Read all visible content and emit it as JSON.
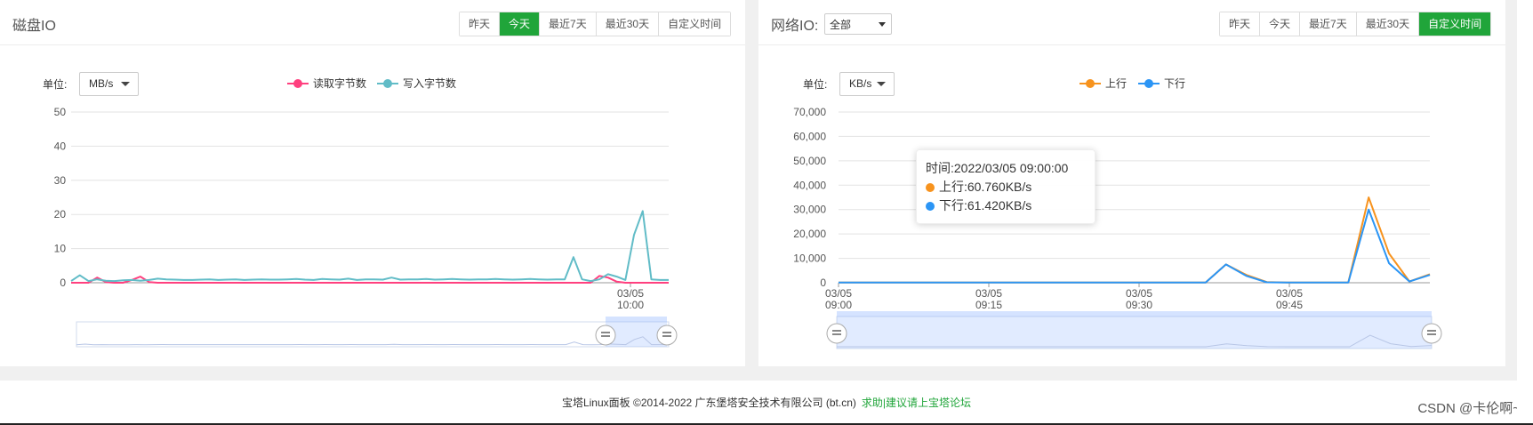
{
  "disk": {
    "title": "磁盘IO",
    "ranges": [
      "昨天",
      "今天",
      "最近7天",
      "最近30天",
      "自定义时间"
    ],
    "active_range": "今天",
    "unit_label": "单位:",
    "unit": "MB/s",
    "legend": [
      "读取字节数",
      "写入字节数"
    ]
  },
  "net": {
    "title": "网络IO:",
    "nic": "全部",
    "ranges": [
      "昨天",
      "今天",
      "最近7天",
      "最近30天",
      "自定义时间"
    ],
    "active_range": "自定义时间",
    "unit_label": "单位:",
    "unit": "KB/s",
    "legend": [
      "上行",
      "下行"
    ],
    "tooltip": {
      "time": "时间:2022/03/05 09:00:00",
      "up": "上行:60.760KB/s",
      "down": "下行:61.420KB/s"
    }
  },
  "colors": {
    "accent": "#20a53a",
    "read": "#ff407f",
    "write": "#61bcc7",
    "up": "#f7931e",
    "down": "#2b95f5"
  },
  "chart_data": [
    {
      "type": "line",
      "title": "",
      "xlabel": "",
      "ylabel": "",
      "ylim": [
        0,
        50
      ],
      "yticks": [
        0,
        10,
        20,
        30,
        40,
        50
      ],
      "xtick_labels": [
        "03/05\n10:00"
      ],
      "x": [
        0,
        1,
        2,
        3,
        4,
        5,
        6,
        7,
        8,
        9,
        10,
        11,
        12,
        13,
        14,
        15,
        16,
        17,
        18,
        19,
        20,
        21,
        22,
        23,
        24,
        25,
        26,
        27,
        28,
        29,
        30,
        31,
        32,
        33,
        34,
        35,
        36,
        37,
        38,
        39,
        40,
        41,
        42,
        43,
        44,
        45,
        46,
        47,
        48,
        49,
        50,
        51,
        52,
        53,
        54,
        55,
        56,
        57,
        58,
        59,
        60,
        61,
        62,
        63,
        64,
        65,
        66,
        67,
        68,
        69
      ],
      "series": [
        {
          "name": "读取字节数",
          "values": [
            0,
            0,
            0,
            1.5,
            0.2,
            0,
            0,
            0.8,
            1.8,
            0.2,
            0,
            0,
            0,
            0,
            0,
            0,
            0,
            0,
            0,
            0,
            0,
            0,
            0,
            0,
            0,
            0,
            0,
            0,
            0,
            0,
            0,
            0,
            0,
            0,
            0,
            0,
            0,
            0,
            0,
            0,
            0,
            0,
            0,
            0,
            0,
            0,
            0,
            0,
            0,
            0,
            0,
            0,
            0,
            0,
            0,
            0,
            0,
            0,
            0,
            0,
            0,
            2.0,
            1.5,
            0.3,
            0,
            0,
            0,
            0,
            0,
            0
          ]
        },
        {
          "name": "写入字节数",
          "values": [
            0.5,
            2.2,
            0.5,
            1.0,
            0.6,
            0.5,
            0.7,
            0.8,
            0.6,
            0.8,
            1.2,
            1.0,
            0.9,
            0.8,
            0.8,
            0.9,
            1.0,
            0.8,
            0.9,
            1.0,
            0.8,
            0.9,
            1.0,
            0.9,
            0.9,
            1.0,
            1.1,
            0.9,
            0.8,
            1.1,
            1.0,
            0.9,
            1.2,
            0.8,
            1.0,
            1.0,
            0.9,
            1.5,
            0.9,
            1.0,
            1.0,
            1.1,
            0.9,
            1.0,
            1.1,
            1.0,
            0.9,
            1.0,
            1.0,
            1.1,
            1.0,
            0.9,
            1.0,
            1.1,
            1.0,
            0.9,
            1.0,
            1.0,
            7.5,
            1.0,
            0.5,
            1.0,
            2.5,
            1.8,
            0.8,
            14.0,
            21.0,
            1.0,
            0.8,
            0.8
          ]
        }
      ]
    },
    {
      "type": "line",
      "title": "",
      "xlabel": "",
      "ylabel": "",
      "ylim": [
        0,
        70000
      ],
      "yticks": [
        0,
        10000,
        20000,
        30000,
        40000,
        50000,
        60000,
        70000
      ],
      "x": [
        "09:00",
        "09:02",
        "09:04",
        "09:06",
        "09:08",
        "09:10",
        "09:12",
        "09:14",
        "09:16",
        "09:18",
        "09:20",
        "09:22",
        "09:24",
        "09:26",
        "09:28",
        "09:30",
        "09:32",
        "09:34",
        "09:36",
        "09:38",
        "09:40",
        "09:42",
        "09:44",
        "09:46",
        "09:48",
        "09:50",
        "09:52",
        "09:54",
        "09:56",
        "09:58"
      ],
      "xtick_labels": [
        "03/05\n09:00",
        "03/05\n09:15",
        "03/05\n09:30",
        "03/05\n09:45"
      ],
      "series": [
        {
          "name": "上行",
          "values": [
            61,
            61,
            61,
            61,
            61,
            61,
            61,
            61,
            61,
            61,
            61,
            61,
            61,
            61,
            61,
            61,
            61,
            61,
            61,
            7500,
            3200,
            300,
            100,
            100,
            100,
            100,
            35000,
            12000,
            500,
            3500
          ]
        },
        {
          "name": "下行",
          "values": [
            61,
            61,
            61,
            61,
            61,
            61,
            61,
            61,
            61,
            61,
            61,
            61,
            61,
            61,
            61,
            61,
            61,
            61,
            61,
            7500,
            2800,
            200,
            100,
            100,
            100,
            100,
            30000,
            8000,
            500,
            3200
          ]
        }
      ]
    }
  ],
  "footer": {
    "text": "宝塔Linux面板 ©2014-2022 广东堡塔安全技术有限公司 (bt.cn)",
    "link": "求助|建议请上宝塔论坛"
  },
  "watermark": "CSDN @卡伦啊~"
}
